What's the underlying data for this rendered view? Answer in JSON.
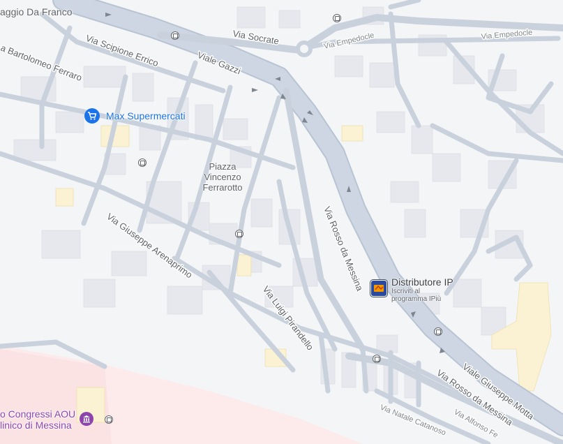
{
  "map": {
    "colors": {
      "background": "#f4f5f7",
      "road": "#c9d1dc",
      "road_major": "#b8c3d2",
      "building": "#e7e9ee",
      "label": "#5f6368",
      "shop": "#1a73e8",
      "fuel_accent": "#f29900",
      "fuel_bg": "#2b4a9b",
      "museum": "#8e44ad",
      "hospital_area": "#fde4e4",
      "highlight_building": "#fbf1d3"
    },
    "road_labels": {
      "via_socrate": "Via Socrate",
      "via_empedocle_1": "Via Empedocle",
      "via_empedocle_2": "Via Empedocle",
      "via_scipione_errico": "Via Scipione Errico",
      "viale_gazzi": "Viale Gazzi",
      "via_bartolomeo_ferraro": "a Bartolomeo Ferraro",
      "via_giuseppe_arenaprimo": "Via Giuseppe Arenaprimo",
      "via_rosso_da_messina_1": "Via Rosso da Messina",
      "via_luigi_pirandello": "Via Luigi Pirandello",
      "viale_giuseppe_motta": "Viale Giuseppe Motta",
      "via_rosso_da_messina_2": "Via Rosso da Messina",
      "via_natale_catanoso": "Via Natale Catanoso",
      "via_alfonso_fe": "Via Alfonso Fe"
    },
    "place_labels": {
      "piazza": "Piazza\nVincenzo\nFerrarotto",
      "top_left": "aggio Da Franco"
    },
    "pois": {
      "max_supermercati": {
        "name": "Max Supermercati",
        "icon": "shopping-cart-icon"
      },
      "distributore_ip": {
        "name": "Distributore IP",
        "subtitle": "Iscriviti al\nprogramma IPiù",
        "icon": "fuel-station-icon"
      },
      "congressi": {
        "name": "o Congressi AOU\nlinico di Messina",
        "icon": "museum-icon"
      }
    },
    "bus_stops": {
      "icon": "bus-stop-icon"
    }
  }
}
